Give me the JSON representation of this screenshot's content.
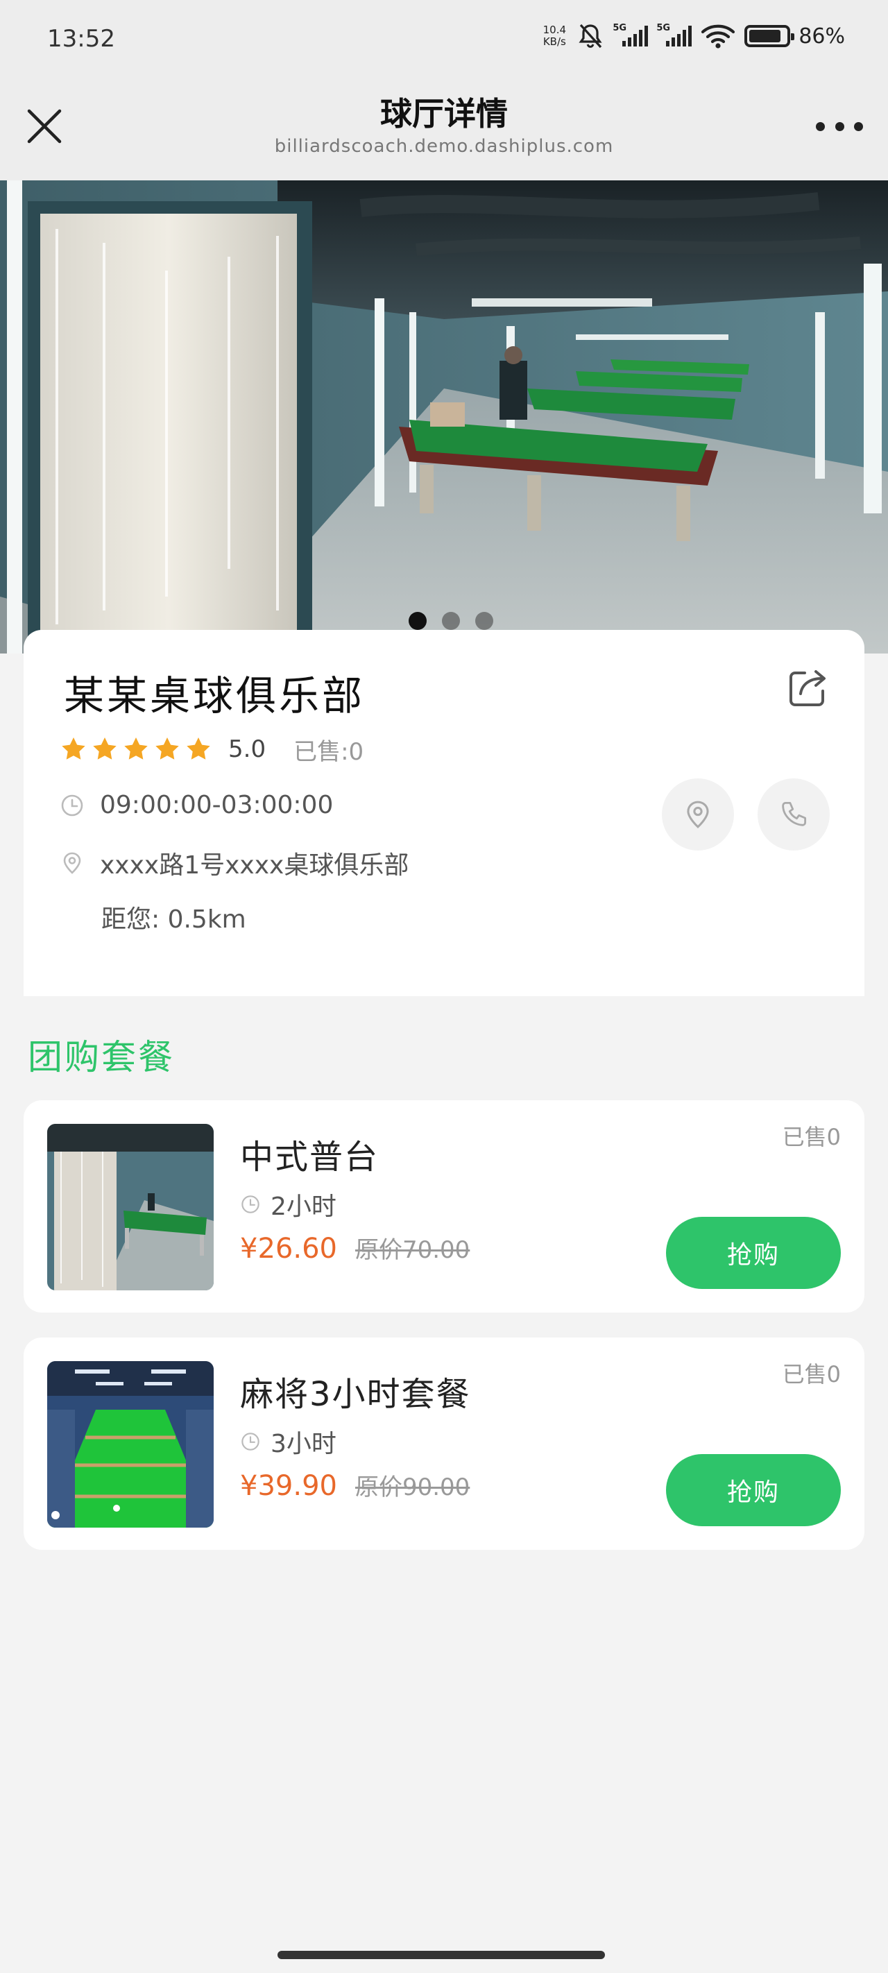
{
  "status_bar": {
    "time": "13:52",
    "net_speed_value": "10.4",
    "net_speed_unit": "KB/s",
    "sim1_tag": "5G",
    "sim2_tag": "5G",
    "battery": "86%",
    "battery_level": 0.86
  },
  "nav": {
    "title": "球厅详情",
    "subtitle": "billiardscoach.demo.dashiplus.com"
  },
  "banner": {
    "slide_count": 3,
    "active_slide": 1
  },
  "club": {
    "name": "某某桌球俱乐部",
    "rating": "5.0",
    "rating_stars": 5,
    "sold": "已售:0",
    "hours": "09:00:00-03:00:00",
    "address": "xxxx路1号xxxx桌球俱乐部",
    "distance": "距您: 0.5km"
  },
  "section": {
    "title": "团购套餐"
  },
  "deals": [
    {
      "name": "中式普台",
      "sold": "已售0",
      "duration": "2小时",
      "price": "¥26.60",
      "original_price": "原价70.00",
      "button": "抢购"
    },
    {
      "name": "麻将3小时套餐",
      "sold": "已售0",
      "duration": "3小时",
      "price": "¥39.90",
      "original_price": "原价90.00",
      "button": "抢购"
    }
  ],
  "colors": {
    "accent_green": "#2ec46a",
    "price_orange": "#e8682a",
    "star_yellow": "#f5a623"
  }
}
